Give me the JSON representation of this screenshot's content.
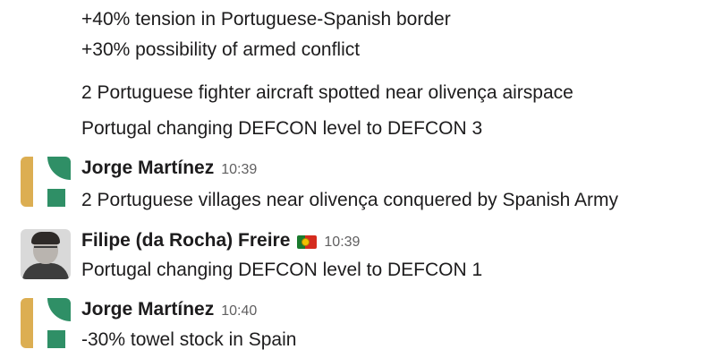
{
  "intro_lines": [
    "+40% tension in Portuguese-Spanish border",
    "+30% possibility of armed conflict",
    "2 Portuguese fighter aircraft spotted near olivença airspace",
    "Portugal changing DEFCON level to DEFCON 3"
  ],
  "messages": [
    {
      "author": "Jorge Martínez",
      "time": "10:39",
      "text": "2 Portuguese villages  near olivença conquered by Spanish Army",
      "avatar": "logo-avatar"
    },
    {
      "author": "Filipe (da Rocha) Freire",
      "status_emoji": "portugal-flag-icon",
      "time": "10:39",
      "text": "Portugal changing DEFCON level to DEFCON 1",
      "avatar": "photo-avatar"
    },
    {
      "author": "Jorge Martínez",
      "time": "10:40",
      "text": "-30% towel stock in Spain",
      "avatar": "logo-avatar"
    }
  ],
  "colors": {
    "text": "#1d1c1d",
    "timestamp": "#616061",
    "logo_gold": "#dcae52",
    "logo_green": "#2f8f66"
  }
}
